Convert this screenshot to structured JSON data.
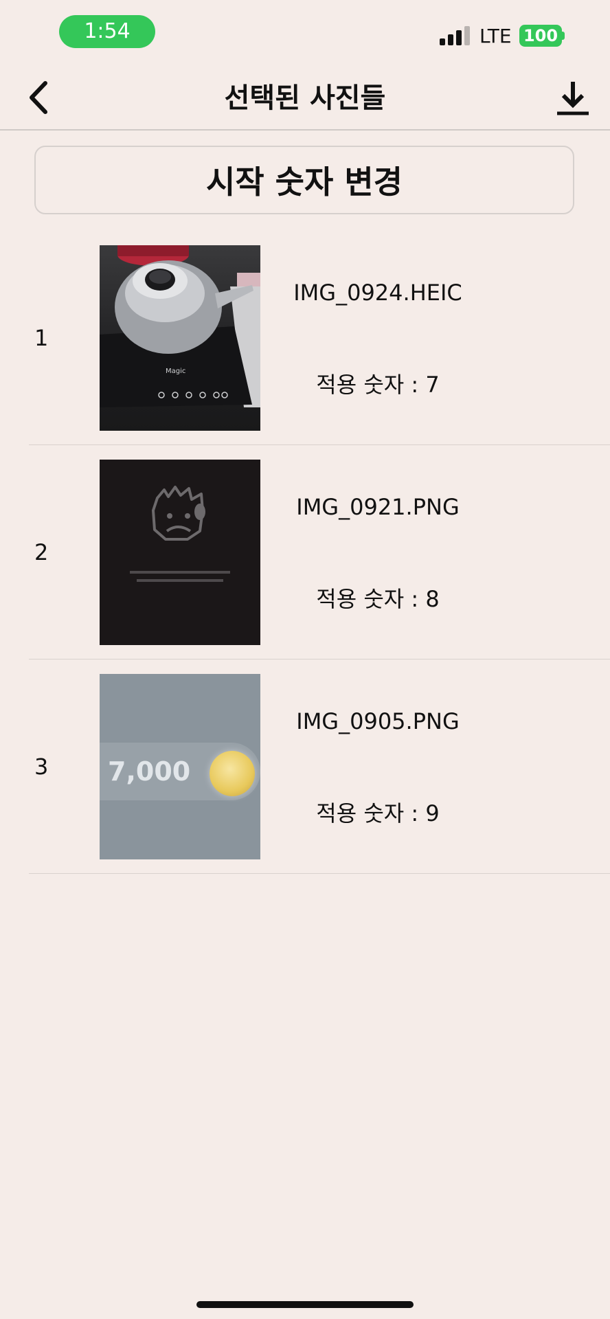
{
  "status_bar": {
    "time": "1:54",
    "network": "LTE",
    "battery": "100"
  },
  "nav": {
    "title": "선택된 사진들",
    "back_icon": "chevron-left-icon",
    "download_icon": "download-icon"
  },
  "change_button": {
    "label": "시작 숫자 변경"
  },
  "photos": [
    {
      "index": "1",
      "filename": "IMG_0924.HEIC",
      "applied": "적용 숫자 : 7"
    },
    {
      "index": "2",
      "filename": "IMG_0921.PNG",
      "applied": "적용 숫자 : 8"
    },
    {
      "index": "3",
      "filename": "IMG_0905.PNG",
      "applied": "적용 숫자 : 9",
      "thumb_text": "7,000"
    }
  ],
  "colors": {
    "background": "#f5ece8",
    "accent_green": "#34c759"
  }
}
